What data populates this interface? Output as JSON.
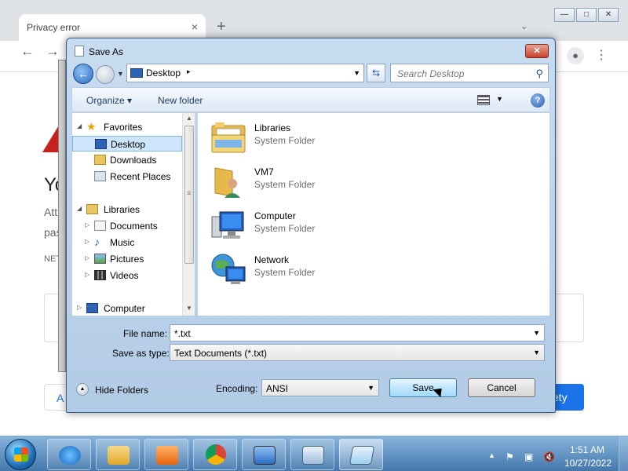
{
  "browser": {
    "tab_title": "Privacy error",
    "tab_close": "×",
    "new_tab": "+",
    "tab_dropdown": "⌄",
    "window_buttons": [
      "—",
      "□",
      "✕"
    ],
    "nav": {
      "back": "←",
      "forward": "→"
    },
    "menu": "⋮",
    "page": {
      "heading_partial": "Yo",
      "line1_partial": "Att",
      "line2_partial": "pas",
      "code_partial": "NET",
      "advanced_partial": "A",
      "safety_partial": "fety"
    }
  },
  "dialog": {
    "title": "Save As",
    "close": "✕",
    "address": "Desktop",
    "address_sep": "▸",
    "search_placeholder": "Search Desktop",
    "organize": "Organize ▾",
    "new_folder": "New folder",
    "help": "?",
    "nav_items": [
      {
        "label": "Favorites",
        "arrow": "◢",
        "icon": "star-icon"
      },
      {
        "label": "Desktop",
        "arrow": "",
        "icon": "desktop-icon",
        "selected": true
      },
      {
        "label": "Downloads",
        "arrow": "",
        "icon": "downloads-folder-icon"
      },
      {
        "label": "Recent Places",
        "arrow": "",
        "icon": "recent-places-icon"
      },
      {
        "label": "Libraries",
        "arrow": "◢",
        "icon": "libraries-icon"
      },
      {
        "label": "Documents",
        "arrow": "▷",
        "icon": "documents-icon"
      },
      {
        "label": "Music",
        "arrow": "▷",
        "icon": "music-icon"
      },
      {
        "label": "Pictures",
        "arrow": "▷",
        "icon": "pictures-icon"
      },
      {
        "label": "Videos",
        "arrow": "▷",
        "icon": "videos-icon"
      },
      {
        "label": "Computer",
        "arrow": "▷",
        "icon": "computer-icon"
      }
    ],
    "files": [
      {
        "name": "Libraries",
        "type": "System Folder",
        "icon": "libraries-folder-icon"
      },
      {
        "name": "VM7",
        "type": "System Folder",
        "icon": "user-folder-icon"
      },
      {
        "name": "Computer",
        "type": "System Folder",
        "icon": "computer-icon"
      },
      {
        "name": "Network",
        "type": "System Folder",
        "icon": "network-icon"
      }
    ],
    "file_name_label": "File name:",
    "file_name_value": "*.txt",
    "save_type_label": "Save as type:",
    "save_type_value": "Text Documents (*.txt)",
    "hide_folders": "Hide Folders",
    "encoding_label": "Encoding:",
    "encoding_value": "ANSI",
    "save_button": "Save",
    "cancel_button": "Cancel"
  },
  "taskbar": {
    "apps": [
      "internet-explorer",
      "file-explorer",
      "media-player",
      "chrome",
      "remote-desktop",
      "control-panel",
      "notepad"
    ],
    "tray": [
      "▲",
      "⚑",
      "▣",
      "🔇"
    ],
    "time": "1:51 AM",
    "date": "10/27/2022"
  }
}
